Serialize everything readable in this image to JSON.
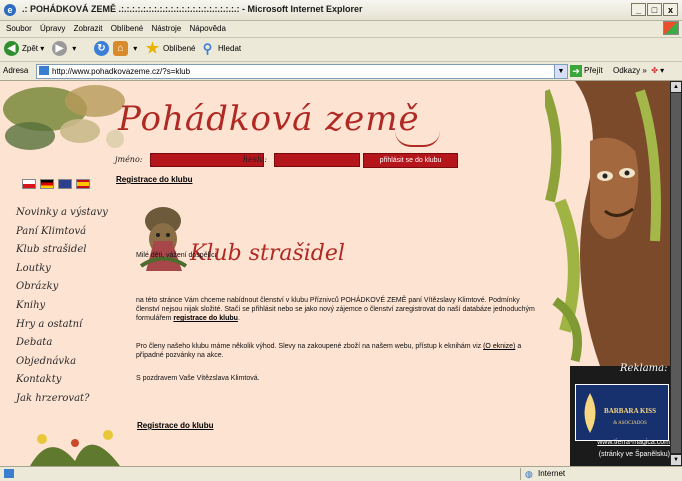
{
  "window": {
    "title": ".: POHÁDKOVÁ ZEMĚ .:.:.:.:.:.:.:.:.:.:.:.:.:.:.:.:.:.:.:.:.:.: - Microsoft Internet Explorer",
    "minimize": "_",
    "maximize": "□",
    "close": "x"
  },
  "menu": [
    "Soubor",
    "Úpravy",
    "Zobrazit",
    "Oblíbené",
    "Nástroje",
    "Nápověda"
  ],
  "toolbar": {
    "back": "Zpět",
    "favorites": "Oblíbené",
    "search": "Hledat"
  },
  "address": {
    "label": "Adresa",
    "url": "http://www.pohadkovazeme.cz/?s=klub",
    "go": "Přejít",
    "links": "Odkazy"
  },
  "site": {
    "logo": "Pohádková země",
    "login": {
      "user_label": "jméno:",
      "pass_label": "heslo:",
      "submit": "přihlásit se do klubu"
    },
    "register_link": "Registrace do klubu",
    "nav": [
      "Novinky a výstavy",
      "Paní Klimtová",
      "Klub strašidel",
      "Loutky",
      "Obrázky",
      "Knihy",
      "Hry a ostatní",
      "Debata",
      "Objednávka",
      "Kontakty",
      "Jak hrzerovat?"
    ],
    "club_title": "Klub strašidel",
    "greeting": "Milé děti, vážení dospělíci,",
    "para1_pre": "na této stránce Vám chceme nabídnout členství v klubu Příznivců POHÁDKOVÉ ZEMĚ paní Vítězslavy Klimtové. Podmínky členství nejsou nijak složité. Stačí se přihlásit nebo se jako nový zájemce o členství zaregistrovat do naší databáze jednoduchým formulářem",
    "para1_link": "registrace do klubu",
    "para1_post": ".",
    "para2_pre": "Pro členy našeho klubu máme několik výhod. Slevy na zakoupené zboží na našem webu, přístup k eknihám viz",
    "para2_link": "(O eknize)",
    "para2_post": "a případné pozvánky na akce.",
    "signoff": "S pozdravem Vaše Vítězslava Klimtová.",
    "bottom_register": "Registrace do klubu",
    "reklama": "Reklama:",
    "ad_title": "BARBARA KISS",
    "ad_sub": "& ASOCIADOS",
    "ad_url": "www.tierra-magica.com",
    "ad_note": "(stránky ve Španělsku)"
  },
  "status": {
    "zone": "Internet"
  }
}
